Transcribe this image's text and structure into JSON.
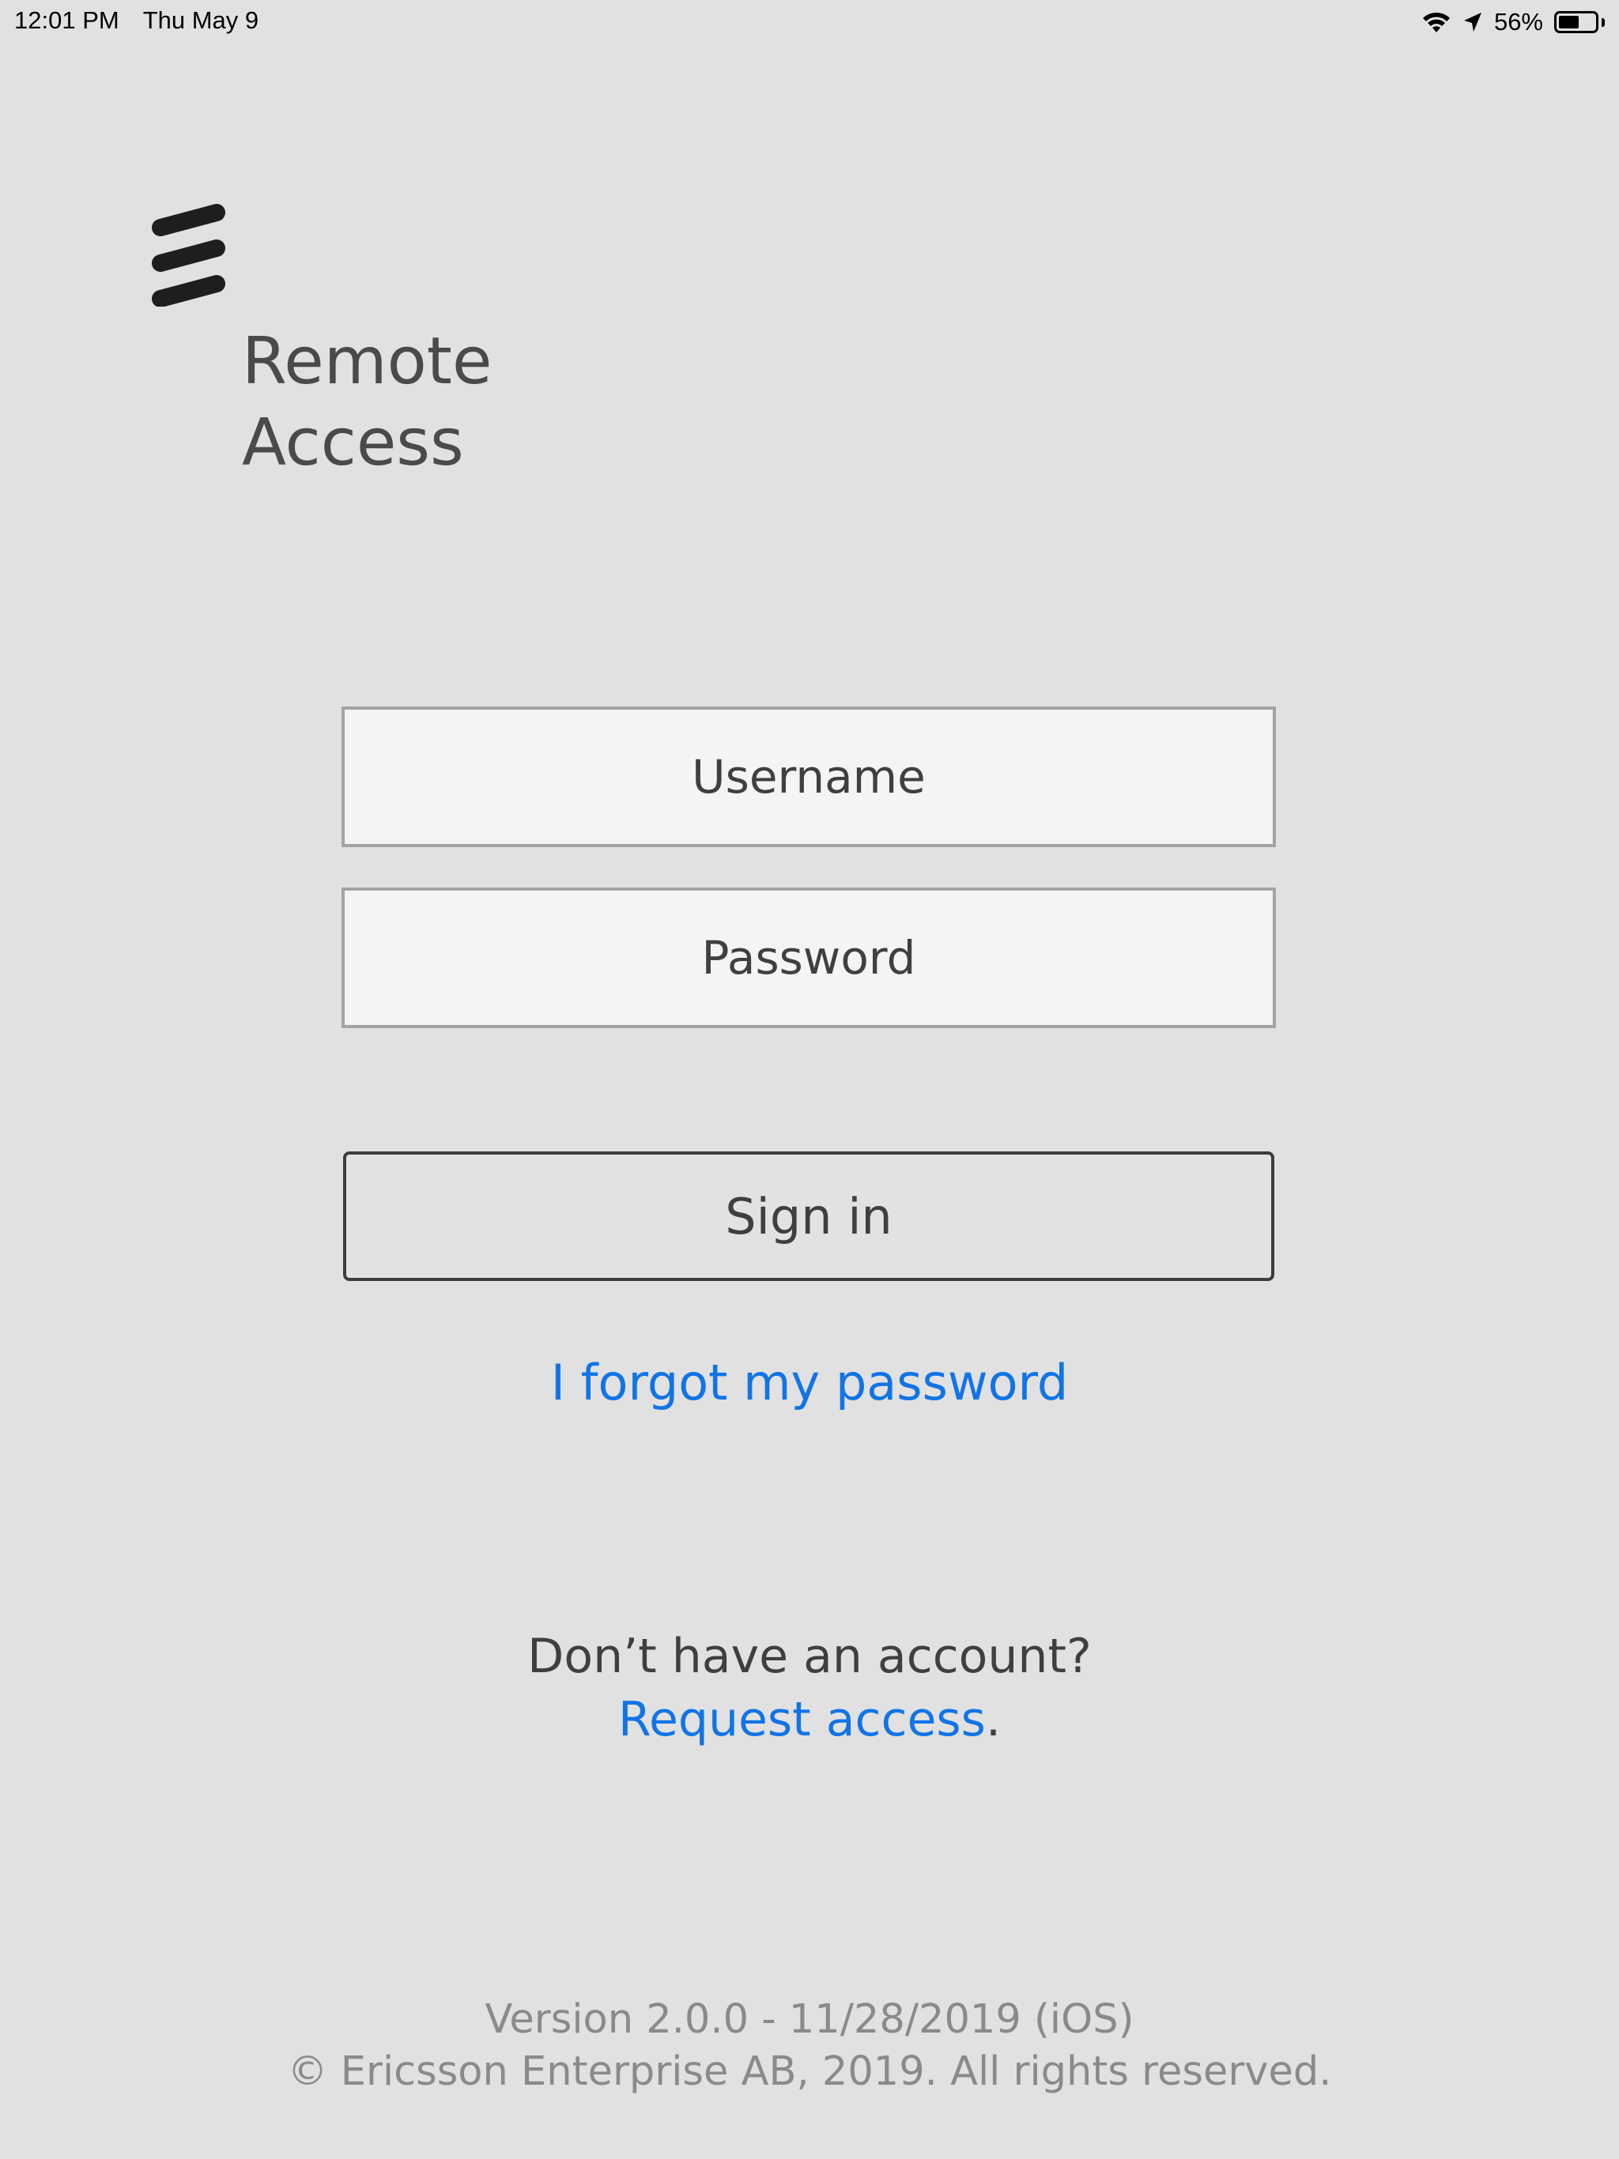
{
  "status_bar": {
    "time": "12:01 PM",
    "date": "Thu May 9",
    "battery_percent": "56%",
    "battery_level": 0.56,
    "icons": [
      "wifi-icon",
      "location-arrow-icon",
      "battery-icon"
    ]
  },
  "app": {
    "logo_icon": "ericsson-logo-icon",
    "title_line1": "Remote",
    "title_line2": "Access"
  },
  "form": {
    "username_placeholder": "Username",
    "password_placeholder": "Password",
    "sign_in_label": "Sign in",
    "forgot_password_label": "I forgot my password"
  },
  "account": {
    "prompt": "Don’t have an account?",
    "request_access_label": "Request access",
    "trailing_period": "."
  },
  "footer": {
    "version": "Version 2.0.0 - 11/28/2019 (iOS)",
    "copyright": "© Ericsson Enterprise AB, 2019.  All rights reserved."
  },
  "colors": {
    "background": "#e1e1e1",
    "link": "#1174e6",
    "text": "#3f3f3f",
    "footer_text": "#8a8a8a"
  }
}
